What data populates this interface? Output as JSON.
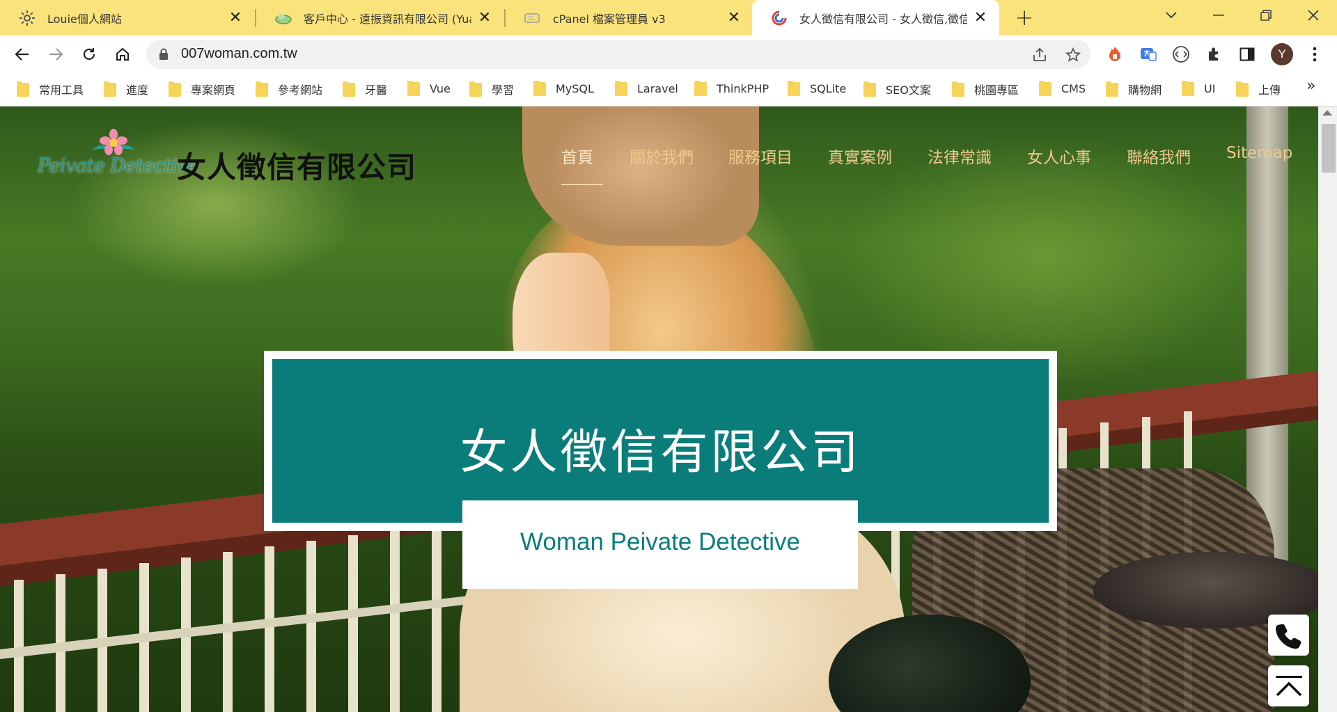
{
  "browser": {
    "tabs": [
      {
        "title": "Louie個人網站",
        "icon": "gear-favicon",
        "close": "✕"
      },
      {
        "title": "客戶中心 - 遠振資訊有限公司 (Yuan",
        "icon": "cloud-favicon",
        "close": "✕"
      },
      {
        "title": "cPanel 檔案管理員 v3",
        "icon": "cpanel-favicon",
        "close": "✕"
      },
      {
        "title": "女人徵信有限公司 - 女人徵信,徵信,",
        "icon": "site-favicon",
        "close": "✕"
      }
    ],
    "new_tab": "+",
    "url": "007woman.com.tw",
    "avatar_letter": "Y",
    "bookmarks": [
      "常用工具",
      "進度",
      "專案網頁",
      "參考網站",
      "牙醫",
      "Vue",
      "學習",
      "MySQL",
      "Laravel",
      "ThinkPHP",
      "SQLite",
      "SEO文案",
      "桃園專區",
      "CMS",
      "購物網",
      "UI",
      "上傳"
    ],
    "bookmarks_more": "»",
    "colors": {
      "tabstrip": "#fbe37c",
      "omnibox": "#f1f1f2",
      "folder": "#f6d45a"
    }
  },
  "site": {
    "logo_script": "Peivate Detective",
    "company_name": "女人徵信有限公司",
    "nav": [
      "首頁",
      "關於我們",
      "服務項目",
      "真實案例",
      "法律常識",
      "女人心事",
      "聯絡我們",
      "Sitemap"
    ],
    "nav_active_index": 0,
    "banner_title": "女人徵信有限公司",
    "banner_subtitle": "Woman Peivate Detective",
    "colors": {
      "teal": "#0a7d7b",
      "nav_text": "#f0c98e"
    },
    "floating_buttons": [
      "phone-icon",
      "back-to-top-icon"
    ]
  }
}
